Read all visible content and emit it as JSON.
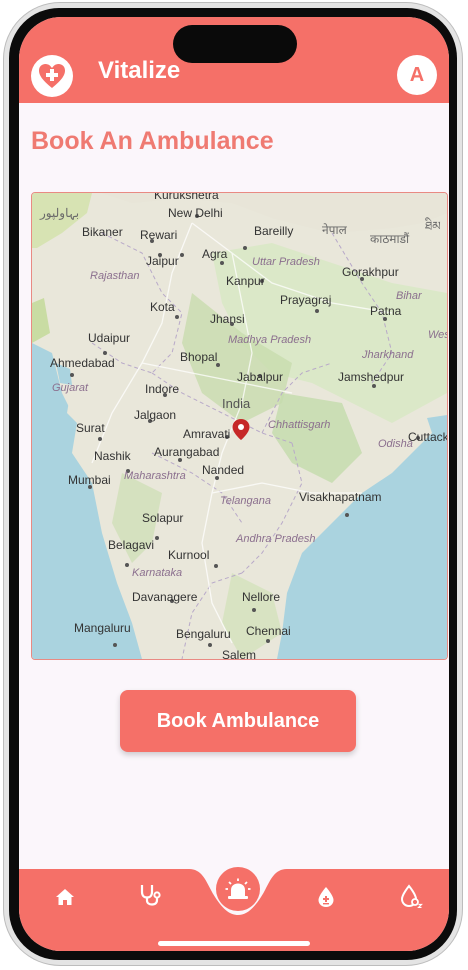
{
  "app": {
    "title": "Vitalize",
    "avatar_initial": "A"
  },
  "page": {
    "title": "Book An Ambulance"
  },
  "map": {
    "country": "India",
    "cities": [
      "Kurukshetra",
      "New Delhi",
      "Bikaner",
      "Rewari",
      "Bareilly",
      "Jaipur",
      "Agra",
      "Kanpur",
      "Gorakhpur",
      "Kota",
      "Prayagraj",
      "Patna",
      "Jhansi",
      "Udaipur",
      "Ahmedabad",
      "Bhopal",
      "Jabalpur",
      "Jamshedpur",
      "Indore",
      "Jalgaon",
      "Surat",
      "Amravati",
      "Cuttack",
      "Nashik",
      "Aurangabad",
      "Nanded",
      "Mumbai",
      "Visakhapatnam",
      "Solapur",
      "Belagavi",
      "Kurnool",
      "Davanagere",
      "Nellore",
      "Mangaluru",
      "Bengaluru",
      "Chennai",
      "Salem"
    ],
    "states": [
      "Rajasthan",
      "Uttar Pradesh",
      "Bihar",
      "Madhya Pradesh",
      "Jharkhand",
      "Gujarat",
      "Chhattisgarh",
      "Odisha",
      "Maharashtra",
      "Telangana",
      "Andhra Pradesh",
      "Karnataka"
    ],
    "foreign": [
      "بہاولپور",
      "नेपाल",
      "काठमाडौं",
      "ཐིམ"
    ],
    "clipped": [
      "Wes"
    ]
  },
  "actions": {
    "book_label": "Book Ambulance"
  },
  "nav": {
    "items": [
      {
        "icon": "home-icon"
      },
      {
        "icon": "stethoscope-icon"
      },
      {
        "icon": "siren-icon"
      },
      {
        "icon": "blood-drop-icon"
      },
      {
        "icon": "oxygen-drop-icon"
      }
    ]
  },
  "colors": {
    "accent": "#f57068",
    "title": "#ef7a72",
    "background": "#fbf6fb",
    "sea": "#aad3df"
  }
}
